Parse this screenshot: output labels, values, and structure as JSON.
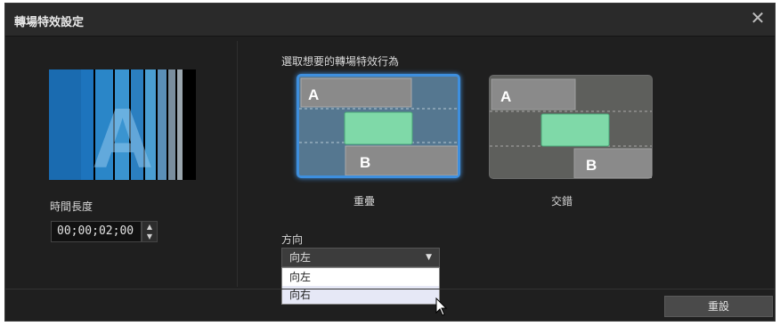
{
  "dialog": {
    "title": "轉場特效設定",
    "close_icon": "close-icon"
  },
  "preview": {
    "letter": "A"
  },
  "duration": {
    "label": "時間長度",
    "value": "00;00;02;00"
  },
  "behavior": {
    "instruction": "選取想要的轉場特效行為",
    "options": [
      {
        "label": "重疊",
        "selected": true,
        "clip_a": "A",
        "clip_b": "B"
      },
      {
        "label": "交錯",
        "selected": false,
        "clip_a": "A",
        "clip_b": "B"
      }
    ]
  },
  "direction": {
    "label": "方向",
    "selected": "向左",
    "options": [
      "向左",
      "向右"
    ],
    "hovered": "向右"
  },
  "footer": {
    "reset_label": "重設"
  },
  "colors": {
    "selection_border": "#3e8fde",
    "clip_green": "#7fd9a8",
    "background": "#1f1f1f"
  }
}
